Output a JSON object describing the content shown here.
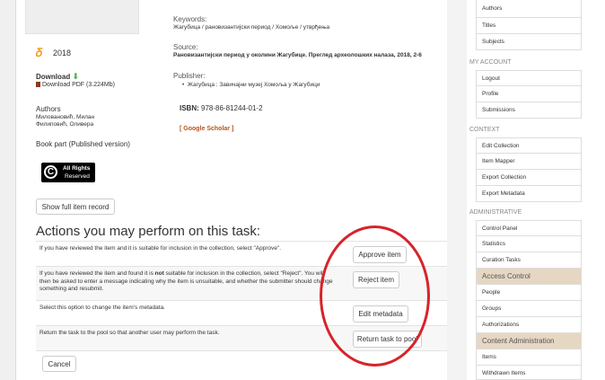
{
  "left": {
    "year": "2018",
    "download_label": "Download",
    "download_link": "Download PDF (3.224Mb)",
    "authors_heading": "Authors",
    "authors": [
      "Миловановић, Милан",
      "Филиповић, Оливера"
    ],
    "item_type": "Book part (Published version)",
    "rights_line1": "All Rights",
    "rights_line2": "Reserved",
    "show_full_button": "Show full item record"
  },
  "details": {
    "keywords_label": "Keywords:",
    "keywords_value": "Жагубица / рановизантијски период / Хомоље / утврђења",
    "source_label": "Source:",
    "source_value": "Рановизантијски период у околини Жагубице. Преглед археолошких налаза, 2018, 2-6",
    "publisher_label": "Publisher:",
    "publisher_value": "Жагубица : Завичајни музеј Хомоља у Жагубици",
    "isbn_label": "ISBN:",
    "isbn_value": "978-86-81244-01-2",
    "google_scholar": "[ Google Scholar ]"
  },
  "tasks": {
    "heading": "Actions you may perform on this task:",
    "rows": [
      {
        "desc": "If you have reviewed the item and it is suitable for inclusion in the collection, select \"Approve\".",
        "button": "Approve item"
      },
      {
        "desc": "If you have reviewed the item and found it is not suitable for inclusion in the collection, select \"Reject\". You will then be asked to enter a message indicating why the item is unsuitable, and whether the submitter should change something and resubmit.",
        "button": "Reject item"
      },
      {
        "desc": "Select this option to change the item's metadata.",
        "button": "Edit metadata"
      },
      {
        "desc": "Return the task to the pool so that another user may perform the task.",
        "button": "Return task to pool"
      }
    ],
    "cancel": "Cancel"
  },
  "sidebar": {
    "browse_items": [
      "Authors",
      "Titles",
      "Subjects"
    ],
    "my_account": {
      "heading": "MY ACCOUNT",
      "items": [
        "Logout",
        "Profile",
        "Submissions"
      ]
    },
    "context": {
      "heading": "CONTEXT",
      "items": [
        "Edit Collection",
        "Item Mapper",
        "Export Collection",
        "Export Metadata"
      ]
    },
    "administrative": {
      "heading": "ADMINISTRATIVE",
      "items": [
        "Control Panel",
        "Statistics",
        "Curation Tasks"
      ],
      "access_control": "Access Control",
      "access_items": [
        "People",
        "Groups",
        "Authorizations"
      ],
      "content_admin": "Content Administration",
      "content_items": [
        "Items",
        "Withdrawn Items"
      ]
    }
  },
  "colors": {
    "annotation_circle": "#d6242a",
    "section_bg": "#e6d7c3",
    "open_access": "#f0a029",
    "link_orange": "#b5531b"
  }
}
